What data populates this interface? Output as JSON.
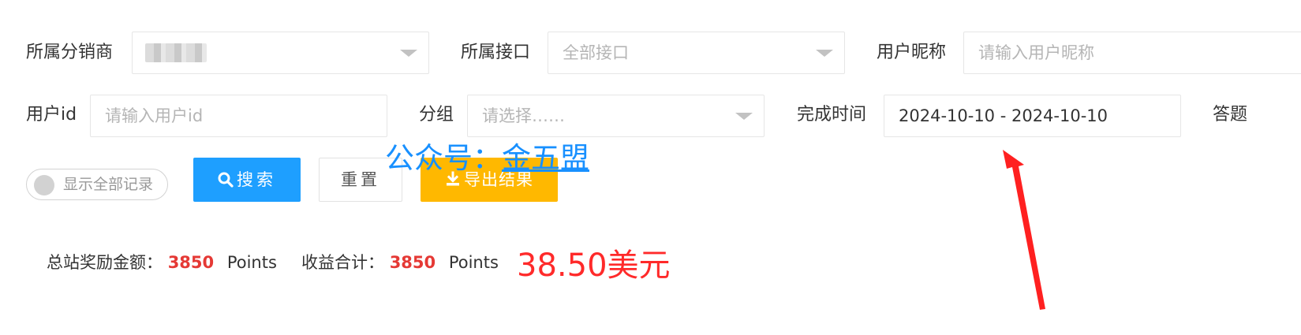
{
  "filters": {
    "distributor": {
      "label": "所属分销商"
    },
    "interface": {
      "label": "所属接口",
      "placeholder": "全部接口"
    },
    "nickname": {
      "label": "用户昵称",
      "placeholder": "请输入用户昵称"
    },
    "user_id": {
      "label": "用户id",
      "placeholder": "请输入用户id"
    },
    "group": {
      "label": "分组",
      "placeholder": "请选择……"
    },
    "completed_time": {
      "label": "完成时间",
      "value": "2024-10-10 - 2024-10-10"
    },
    "cut_off_label": "答题"
  },
  "actions": {
    "show_all_toggle": "显示全部记录",
    "search": "搜索",
    "reset": "重置",
    "export": "导出结果"
  },
  "watermark": {
    "prefix": "公众号：",
    "name": "金五盟"
  },
  "summary": {
    "reward_label": "总站奖励金额：",
    "reward_value": "3850",
    "reward_unit": "Points",
    "income_label": "收益合计：",
    "income_value": "3850",
    "income_unit": "Points",
    "usd": "38.50美元"
  },
  "colors": {
    "primary": "#1e9fff",
    "warn": "#ffb800",
    "annotation_arrow": "#ff2020",
    "highlight_number": "#e53935"
  },
  "icons": [
    "search-icon",
    "download-icon",
    "chevron-down-icon",
    "annotation-arrow"
  ]
}
